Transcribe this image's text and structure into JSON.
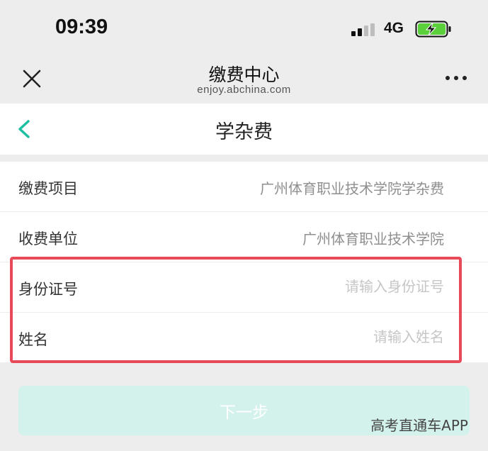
{
  "status_bar": {
    "time": "09:39",
    "network": "4G"
  },
  "nav": {
    "title": "缴费中心",
    "subtitle": "enjoy.abchina.com"
  },
  "page": {
    "title": "学杂费"
  },
  "form": {
    "rows": [
      {
        "label": "缴费项目",
        "value": "广州体育职业技术学院学杂费"
      },
      {
        "label": "收费单位",
        "value": "广州体育职业技术学院"
      },
      {
        "label": "身份证号",
        "value": "",
        "placeholder": "请输入身份证号"
      },
      {
        "label": "姓名",
        "value": "",
        "placeholder": "请输入姓名"
      }
    ]
  },
  "next_button": {
    "label": "下一步"
  },
  "watermark": "高考直通车APP",
  "colors": {
    "accent": "#1fbfa2",
    "highlight": "#e84a5a",
    "button_disabled": "#d3f2ec",
    "battery_green": "#5ad13b"
  }
}
